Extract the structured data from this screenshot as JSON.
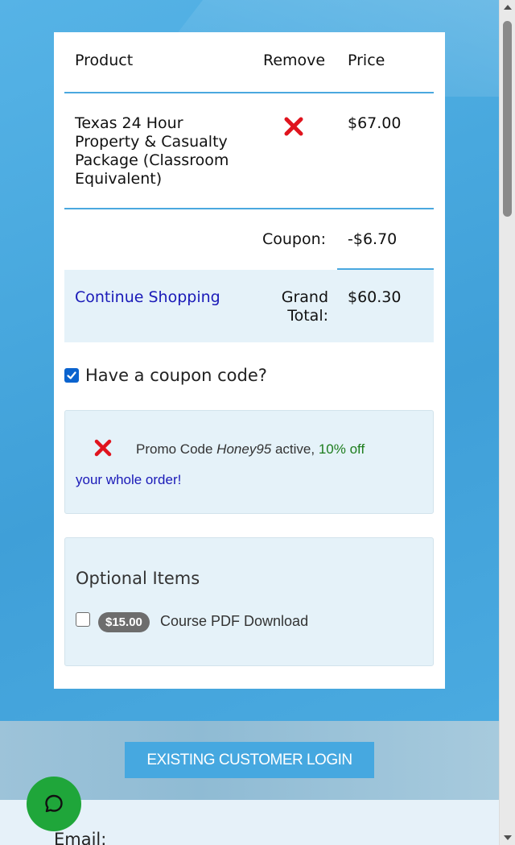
{
  "cart": {
    "headers": {
      "product": "Product",
      "remove": "Remove",
      "price": "Price"
    },
    "item": {
      "name_lines": [
        "Texas 24 Hour",
        "Property & Casualty",
        "Package (Classroom",
        "Equivalent)"
      ],
      "price": "$67.00"
    },
    "coupon_label": "Coupon:",
    "coupon_value": "-$6.70",
    "continue_shopping": "Continue Shopping",
    "grand_total_lines": [
      "Grand",
      "Total:"
    ],
    "grand_total_value": "$60.30"
  },
  "coupon": {
    "checkbox_label": "Have a coupon code?",
    "checked": true,
    "promo": {
      "prefix": "Promo Code ",
      "code": "Honey95",
      "middle": " active, ",
      "discount": "10% off",
      "suffix": "your whole order!"
    }
  },
  "optional": {
    "title": "Optional Items",
    "item_price": "$15.00",
    "item_label": "Course PDF Download",
    "checked": false
  },
  "login_button": "EXISTING CUSTOMER LOGIN",
  "email_label": "Email:",
  "icons": {
    "remove": "red-x-icon",
    "chat": "chat-bubble-icon",
    "checkbox": "checkmark-icon"
  },
  "colors": {
    "accent_line": "#4aa8df",
    "link": "#1a1ab8",
    "discount_green": "#1e7d1e",
    "remove_red": "#e0141e",
    "chat_green": "#1fa63a",
    "login_button": "#46a8e0"
  }
}
